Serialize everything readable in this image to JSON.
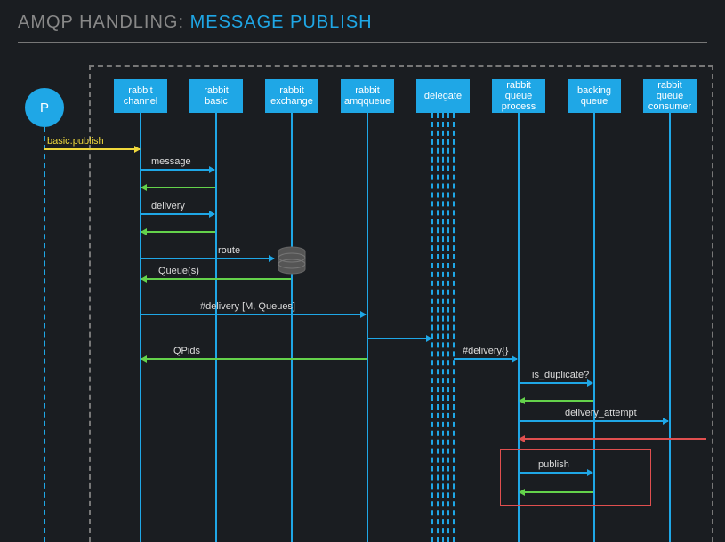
{
  "title": {
    "main": "AMQP HANDLING: ",
    "sub": "MESSAGE PUBLISH"
  },
  "participants": {
    "p": "P",
    "channel": "rabbit\nchannel",
    "basic": "rabbit\nbasic",
    "exchange": "rabbit\nexchange",
    "amqqueue": "rabbit\namqqueue",
    "delegate": "delegate",
    "qprocess": "rabbit\nqueue\nprocess",
    "backing": "backing\nqueue",
    "consumer": "rabbit\nqueue\nconsumer"
  },
  "messages": {
    "basic_publish": "basic.publish",
    "message": "message",
    "delivery": "delivery",
    "route": "route",
    "queues": "Queue(s)",
    "delivery_m_queues": "#delivery [M, Queues]",
    "qpids": "QPids",
    "delivery_braces": "#delivery{}",
    "is_duplicate": "is_duplicate?",
    "delivery_attempt": "delivery_attempt",
    "publish": "publish"
  },
  "chart_data": {
    "type": "sequence",
    "title": "AMQP HANDLING: MESSAGE PUBLISH",
    "participants": [
      "P",
      "rabbit channel",
      "rabbit basic",
      "rabbit exchange",
      "rabbit amqqueue",
      "delegate",
      "rabbit queue process",
      "backing queue",
      "rabbit queue consumer"
    ],
    "interactions": [
      {
        "from": "P",
        "to": "rabbit channel",
        "label": "basic.publish",
        "style": "request-yellow"
      },
      {
        "from": "rabbit channel",
        "to": "rabbit basic",
        "label": "message",
        "style": "call-blue"
      },
      {
        "from": "rabbit basic",
        "to": "rabbit channel",
        "label": "",
        "style": "return-green"
      },
      {
        "from": "rabbit channel",
        "to": "rabbit basic",
        "label": "delivery",
        "style": "call-blue"
      },
      {
        "from": "rabbit basic",
        "to": "rabbit channel",
        "label": "",
        "style": "return-green"
      },
      {
        "from": "rabbit channel",
        "to": "rabbit exchange",
        "label": "route",
        "style": "call-blue"
      },
      {
        "from": "rabbit exchange",
        "to": "rabbit channel",
        "label": "Queue(s)",
        "style": "return-green"
      },
      {
        "from": "rabbit channel",
        "to": "rabbit amqqueue",
        "label": "#delivery [M, Queues]",
        "style": "call-blue"
      },
      {
        "from": "rabbit amqqueue",
        "to": "delegate",
        "label": "",
        "style": "call-blue"
      },
      {
        "from": "delegate",
        "to": "rabbit queue process",
        "label": "#delivery{}",
        "style": "call-blue"
      },
      {
        "from": "rabbit amqqueue",
        "to": "rabbit channel",
        "label": "QPids",
        "style": "return-green"
      },
      {
        "from": "rabbit queue process",
        "to": "backing queue",
        "label": "is_duplicate?",
        "style": "call-blue"
      },
      {
        "from": "backing queue",
        "to": "rabbit queue process",
        "label": "",
        "style": "return-green"
      },
      {
        "from": "rabbit queue process",
        "to": "rabbit queue consumer",
        "label": "delivery_attempt",
        "style": "call-blue"
      },
      {
        "from": "rabbit queue consumer",
        "to": "rabbit queue process",
        "label": "",
        "style": "return-red"
      },
      {
        "from": "rabbit queue process",
        "to": "backing queue",
        "label": "publish",
        "style": "call-blue",
        "group": "red-box"
      },
      {
        "from": "backing queue",
        "to": "rabbit queue process",
        "label": "",
        "style": "return-green",
        "group": "red-box"
      }
    ]
  }
}
